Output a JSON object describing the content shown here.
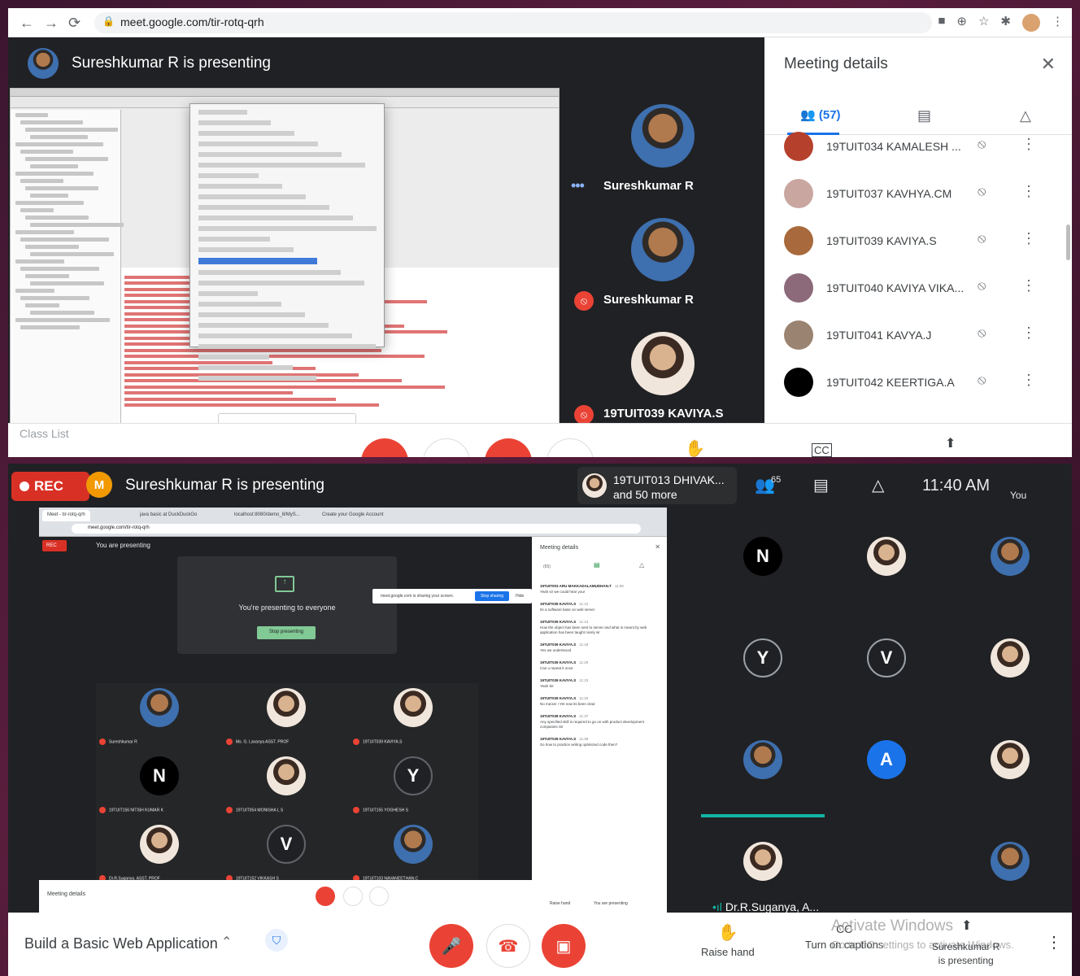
{
  "browser": {
    "url": "meet.google.com/tir-rotq-qrh"
  },
  "top_meet": {
    "presenting_title": "Sureshkumar R is presenting",
    "tiles": [
      {
        "name": "Sureshkumar R",
        "status": "speaking"
      },
      {
        "name": "Sureshkumar R",
        "status": "muted"
      },
      {
        "name": "19TUIT039 KAVIYA.S",
        "status": "muted"
      }
    ],
    "details": {
      "title": "Meeting details",
      "people_count": "(57)",
      "participants": [
        {
          "name": "19TUIT034 KAMALESH ...",
          "color": "#b5412c"
        },
        {
          "name": "19TUIT037 KAVHYA.CM",
          "color": "#c9a7a0"
        },
        {
          "name": "19TUIT039 KAVIYA.S",
          "color": "#a86a3c"
        },
        {
          "name": "19TUIT040 KAVIYA VIKA...",
          "color": "#8c6a7a"
        },
        {
          "name": "19TUIT041 KAVYA.J",
          "color": "#9a8370"
        },
        {
          "name": "19TUIT042 KEERTIGA.A",
          "color": "#000000"
        }
      ]
    },
    "class_list": "Class List"
  },
  "bottom_meet": {
    "rec_label": "REC",
    "presenting_title": "Sureshkumar R is presenting",
    "speaker_line1": "19TUIT013 DHIVAK...",
    "speaker_line2": "and 50 more",
    "people_count": "65",
    "clock": "11:40 AM",
    "you_label": "You",
    "you_initial": "M",
    "inner": {
      "tabs": [
        "Meet - tir-rotq-qrh",
        "java basic at DuckDuckGo",
        "localhost:8080/demo_8/MyS...",
        "Create your Google Account"
      ],
      "url": "meet.google.com/tir-rotq-qrh",
      "rec": "REC",
      "you_presenting": "You are presenting",
      "presenting_msg": "You're presenting to everyone",
      "stop_presenting": "Stop presenting",
      "share_notice": "meet.google.com is sharing your screen.",
      "stop_sharing": "Stop sharing",
      "hide": "Hide",
      "panel_title": "Meeting details",
      "panel_count": "(65)",
      "participants": [
        {
          "name": "Sureshkumar R",
          "initial": "",
          "bg": "face"
        },
        {
          "name": "Ms. G. Lavanya ASST. PROF",
          "initial": "",
          "bg": "face2"
        },
        {
          "name": "19TUIT039 KAVIYA.S",
          "initial": "",
          "bg": "face2"
        },
        {
          "name": "19TUIT156 NITISH KUMAR K",
          "initial": "N",
          "bg": "#000000"
        },
        {
          "name": "19TUIT054 MONISHA L S",
          "initial": "",
          "bg": "face2"
        },
        {
          "name": "19TUIT155 YOGHESH S",
          "initial": "Y",
          "bg": "#202124"
        },
        {
          "name": "Dr.R.Suganya. ASST. PROF",
          "initial": "",
          "bg": "face2"
        },
        {
          "name": "19TUIT152 VIKKASH S",
          "initial": "V",
          "bg": "#202124"
        },
        {
          "name": "19TUIT103 NAVANEETHAN.C",
          "initial": "",
          "bg": "face"
        }
      ],
      "messages": [
        {
          "who": "19TUIT003 ARU MAKKADALAMUDHAN.T",
          "time": "11:09",
          "text": "Yeah sir we could hear you!"
        },
        {
          "who": "19TUIT039 KAVIYA.S",
          "time": "11:12",
          "text": "Its a software base on web server"
        },
        {
          "who": "19TUIT039 KAVIYA.S",
          "time": "11:13",
          "text": "How the object has been sent to server and what is meant by web application has been taught nicely sir"
        },
        {
          "who": "19TUIT039 KAVIYA.S",
          "time": "11:18",
          "text": "Yes we understood"
        },
        {
          "who": "19TUIT039 KAVIYA.S",
          "time": "11:20",
          "text": "Can u repeat it once"
        },
        {
          "who": "19TUIT039 KAVIYA.S",
          "time": "11:23",
          "text": "Yeah Sir"
        },
        {
          "who": "19TUIT039 KAVIYA.S",
          "time": "11:33",
          "text": "No ma'am ! Yet now its been clear"
        },
        {
          "who": "19TUIT039 KAVIYA.S",
          "time": "11:37",
          "text": "Any specified skill is required to go on with product development companies Sir"
        },
        {
          "who": "19TUIT039 KAVIYA.S",
          "time": "11:38",
          "text": "So how to practice writing optimized code then?"
        }
      ],
      "meeting_details": "Meeting details",
      "raise_hand": "Raise hand",
      "you_are_presenting": "You are presenting"
    },
    "grid": [
      {
        "initial": "N",
        "bg": "#000000"
      },
      {
        "initial": "",
        "bg": "face2"
      },
      {
        "initial": "",
        "bg": "face"
      },
      {
        "initial": "Y",
        "bg": "#202124"
      },
      {
        "initial": "V",
        "bg": "#202124"
      },
      {
        "initial": "",
        "bg": "face2"
      },
      {
        "initial": "",
        "bg": "face"
      },
      {
        "initial": "A",
        "bg": "#1a73e8"
      },
      {
        "initial": "",
        "bg": "face2"
      },
      {
        "initial": "",
        "bg": "face2",
        "name": "Dr.R.Suganya, A..."
      },
      {
        "initial": "",
        "bg": "#202124"
      },
      {
        "initial": "",
        "bg": "face"
      }
    ],
    "controls": {
      "meeting_name": "Build a Basic Web Application",
      "raise_hand": "Raise hand",
      "captions": "Turn on captions",
      "presenter_line1": "Sureshkumar R",
      "presenter_line2": "is presenting",
      "activate_line1": "Activate Windows",
      "activate_line2": "Go to PC settings to activate Windows."
    }
  }
}
